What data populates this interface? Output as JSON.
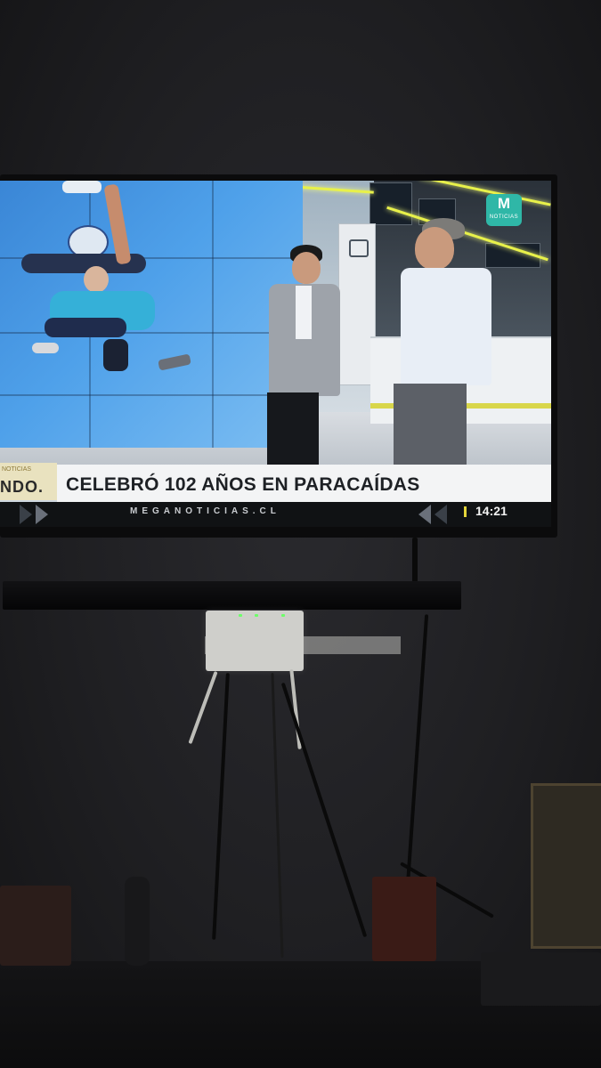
{
  "broadcast": {
    "channel_logo": {
      "mark": "M",
      "label": "NOTICIAS"
    },
    "lower_third_left": {
      "top_text": "NOTICIAS",
      "text": "NDO."
    },
    "headline": "CELEBRÓ 102 AÑOS EN PARACAÍDAS",
    "ticker": "MEGANOTICIAS.CL",
    "clock": "14:21"
  },
  "colors": {
    "logo": "#2fb7a7",
    "accent_light": "#e8f14a",
    "headline_bg": "#f3f4f5",
    "ticker_bg": "#101214"
  }
}
